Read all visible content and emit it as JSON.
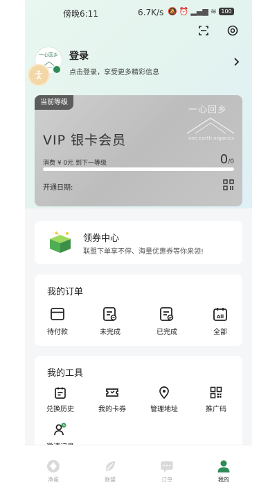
{
  "status": {
    "time": "傍晚6:11",
    "net": "6.7K/s",
    "battery": "100"
  },
  "profile": {
    "title": "登录",
    "subtitle": "点击登录，享受更多精彩信息",
    "avatar_text": "一心回乡"
  },
  "vip": {
    "tag": "当前等级",
    "brand": "一心回乡",
    "brand_en": "one earth organics",
    "title": "VIP 银卡会员",
    "consume": "消费 ¥ 0元 到下一等级",
    "count": "0",
    "count_total": "/0",
    "progress": 0,
    "open_date_label": "开通日期:"
  },
  "coupon": {
    "title": "领券中心",
    "subtitle": "联盟下单享不停、海量优惠券等你来领!"
  },
  "orders": {
    "title": "我的订单",
    "items": [
      {
        "label": "待付款",
        "icon": "card-icon"
      },
      {
        "label": "未完成",
        "icon": "doc-pending-icon"
      },
      {
        "label": "已完成",
        "icon": "doc-done-icon"
      },
      {
        "label": "全部",
        "icon": "calendar-all-icon"
      }
    ]
  },
  "tools": {
    "title": "我的工具",
    "items": [
      {
        "label": "兑换历史",
        "icon": "clipboard-icon"
      },
      {
        "label": "我的卡券",
        "icon": "ticket-icon"
      },
      {
        "label": "管理地址",
        "icon": "location-icon"
      },
      {
        "label": "推广码",
        "icon": "qrcode-icon"
      },
      {
        "label": "邀请记录",
        "icon": "user-clock-icon"
      }
    ]
  },
  "nav": [
    {
      "label": "净蛋",
      "active": false
    },
    {
      "label": "联盟",
      "active": false
    },
    {
      "label": "订单",
      "active": false
    },
    {
      "label": "我的",
      "active": true
    }
  ],
  "colors": {
    "accent": "#2f8a58",
    "vip_card": "#c4c4c4"
  }
}
